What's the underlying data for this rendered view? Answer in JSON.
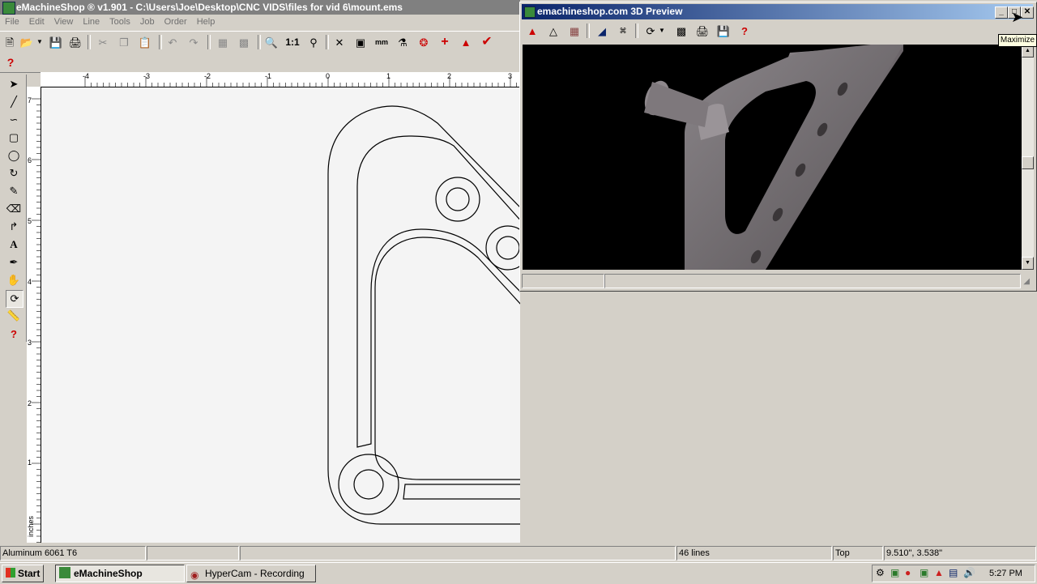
{
  "main_window": {
    "title": "eMachineShop ® v1.901 - C:\\Users\\Joe\\Desktop\\CNC VIDS\\files for vid 6\\mount.ems"
  },
  "menu": [
    "File",
    "Edit",
    "View",
    "Line",
    "Tools",
    "Job",
    "Order",
    "Help"
  ],
  "ruler": {
    "top_labels": [
      "-4",
      "-3",
      "-2",
      "-1",
      "0",
      "1",
      "2",
      "3"
    ],
    "left_labels": [
      "7",
      "6",
      "5",
      "4",
      "3",
      "2",
      "1"
    ],
    "units": "inches"
  },
  "status": {
    "material": "Aluminum 6061 T6",
    "lines": "46 lines",
    "view": "Top",
    "coords": "9.510\", 3.538\""
  },
  "preview_window": {
    "title": "emachineshop.com 3D Preview"
  },
  "tooltip": "Maximize",
  "taskbar": {
    "start": "Start",
    "tasks": [
      {
        "label": "eMachineShop",
        "active": true
      },
      {
        "label": "HyperCam - Recording",
        "active": false
      }
    ],
    "clock": "5:27 PM"
  },
  "icons": {
    "left_tools": [
      "select-arrow-icon",
      "line-icon",
      "spline-icon",
      "rectangle-icon",
      "circle-icon",
      "arc-icon",
      "brush-icon",
      "eraser-icon",
      "fillet-icon",
      "text-icon",
      "pen-icon",
      "hand-icon",
      "rotate-icon",
      "measure-icon",
      "help-icon"
    ],
    "accent_red": "#cc0000",
    "accent_green": "#1f8a1f"
  },
  "colors": {
    "title_active_start": "#0a246a",
    "title_active_end": "#a6caf0",
    "title_inactive": "#808080",
    "chrome": "#d4d0c8",
    "canvas": "#f4f4f4"
  }
}
